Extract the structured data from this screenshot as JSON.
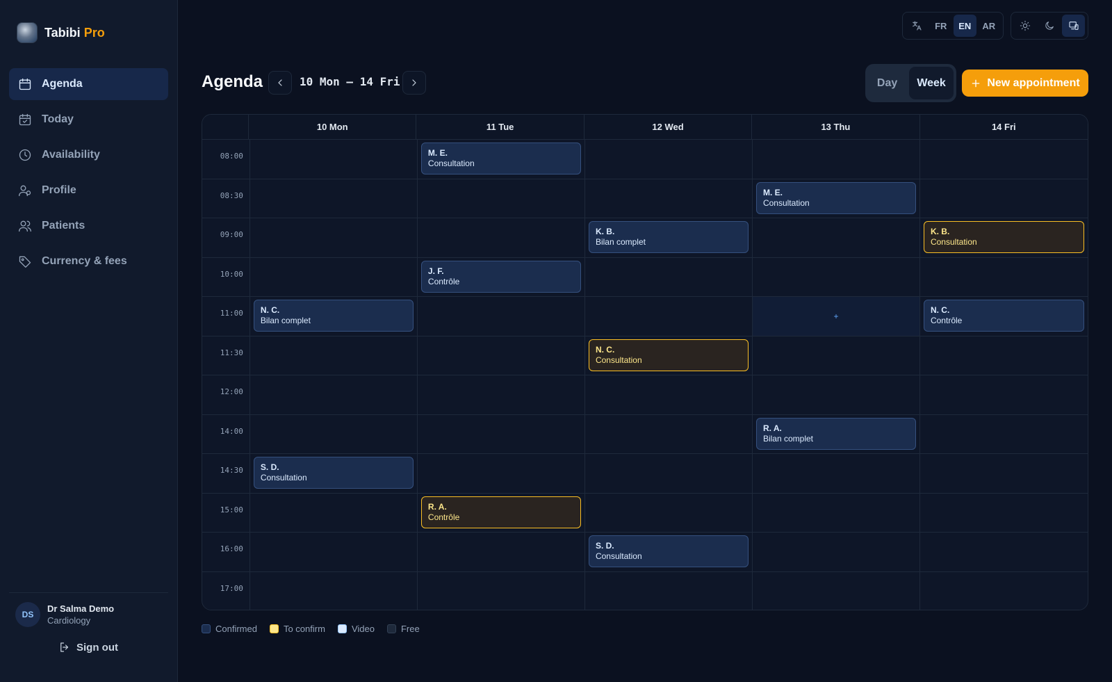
{
  "brand": {
    "name": "Tabibi",
    "accent": "Pro"
  },
  "colors": {
    "accent": "#f59e0b",
    "confirmed": "#1b2d4e",
    "to_confirm": "#fbbf24",
    "video": "#dbeafe",
    "free": "#1e293b",
    "background": "#0b1120"
  },
  "nav": [
    {
      "label": "Agenda",
      "icon": "calendar-icon",
      "active": true
    },
    {
      "label": "Today",
      "icon": "calendar-check-icon"
    },
    {
      "label": "Availability",
      "icon": "clock-icon"
    },
    {
      "label": "Profile",
      "icon": "user-icon"
    },
    {
      "label": "Patients",
      "icon": "users-icon"
    },
    {
      "label": "Currency & fees",
      "icon": "tag-icon"
    }
  ],
  "user": {
    "initials": "DS",
    "name": "Dr Salma Demo",
    "specialty": "Cardiology"
  },
  "signout": "Sign out",
  "languages": [
    {
      "label": "FR"
    },
    {
      "label": "EN",
      "active": true
    },
    {
      "label": "AR"
    }
  ],
  "theme_modes": [
    "sun-icon",
    "moon-icon",
    "monitor-icon"
  ],
  "header": {
    "title": "Agenda",
    "range": "10 Mon – 14 Fri"
  },
  "view": {
    "day": "Day",
    "week": "Week",
    "selected": "Week"
  },
  "new_button": "New appointment",
  "calendar": {
    "days": [
      "10 Mon",
      "11 Tue",
      "12 Wed",
      "13 Thu",
      "14 Fri"
    ],
    "times": [
      "08:00",
      "08:30",
      "09:00",
      "10:00",
      "11:00",
      "11:30",
      "12:00",
      "14:00",
      "14:30",
      "15:00",
      "16:00",
      "17:00"
    ],
    "free_slot": {
      "time": "11:00",
      "day": "13 Thu",
      "label": "+"
    },
    "appointments": [
      {
        "time": "08:00",
        "day": "11 Tue",
        "patient": "M. E.",
        "type": "Consultation",
        "status": "confirmed"
      },
      {
        "time": "08:30",
        "day": "13 Thu",
        "patient": "M. E.",
        "type": "Consultation",
        "status": "confirmed"
      },
      {
        "time": "09:00",
        "day": "12 Wed",
        "patient": "K. B.",
        "type": "Bilan complet",
        "status": "confirmed"
      },
      {
        "time": "09:00",
        "day": "14 Fri",
        "patient": "K. B.",
        "type": "Consultation",
        "status": "to_confirm"
      },
      {
        "time": "10:00",
        "day": "11 Tue",
        "patient": "J. F.",
        "type": "Contrôle",
        "status": "confirmed"
      },
      {
        "time": "11:00",
        "day": "10 Mon",
        "patient": "N. C.",
        "type": "Bilan complet",
        "status": "confirmed"
      },
      {
        "time": "11:00",
        "day": "14 Fri",
        "patient": "N. C.",
        "type": "Contrôle",
        "status": "confirmed"
      },
      {
        "time": "11:30",
        "day": "12 Wed",
        "patient": "N. C.",
        "type": "Consultation",
        "status": "to_confirm"
      },
      {
        "time": "14:00",
        "day": "13 Thu",
        "patient": "R. A.",
        "type": "Bilan complet",
        "status": "confirmed"
      },
      {
        "time": "14:30",
        "day": "10 Mon",
        "patient": "S. D.",
        "type": "Consultation",
        "status": "confirmed"
      },
      {
        "time": "15:00",
        "day": "11 Tue",
        "patient": "R. A.",
        "type": "Contrôle",
        "status": "to_confirm"
      },
      {
        "time": "16:00",
        "day": "12 Wed",
        "patient": "S. D.",
        "type": "Consultation",
        "status": "confirmed"
      }
    ]
  },
  "legend": [
    {
      "label": "Confirmed",
      "color": "#1b2d4e",
      "border": "#35507e"
    },
    {
      "label": "To confirm",
      "color": "#fde68a",
      "border": "#fbbf24"
    },
    {
      "label": "Video",
      "color": "#dbeafe",
      "border": "#93c5fd"
    },
    {
      "label": "Free",
      "color": "#1e293b",
      "border": "#334155"
    }
  ]
}
